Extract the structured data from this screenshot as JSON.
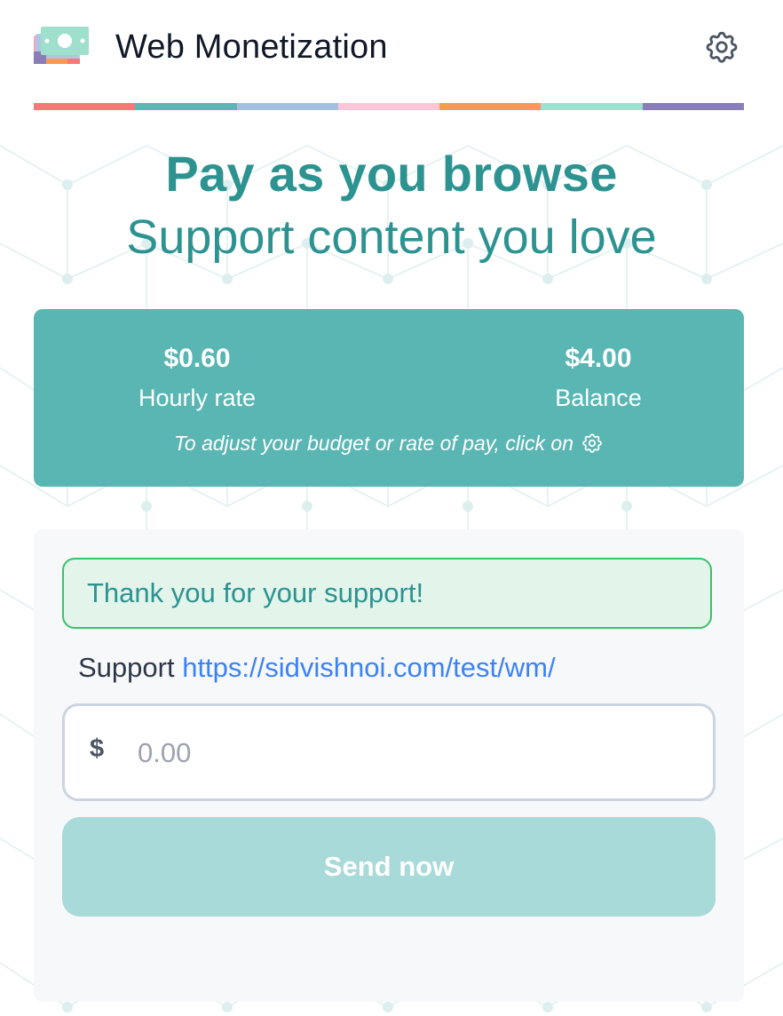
{
  "header": {
    "title": "Web Monetization",
    "logo_icon": "money-bill-icon",
    "settings_icon": "gear-icon"
  },
  "rainbow_colors": [
    "#f87878",
    "#5bb7b4",
    "#a4bfdf",
    "#fdc6d6",
    "#f89a53",
    "#9fe0cc",
    "#8a7db8"
  ],
  "hero": {
    "headline": "Pay as you browse",
    "subheadline": "Support content you love"
  },
  "stats": {
    "hourly_rate_value": "$0.60",
    "hourly_rate_label": "Hourly rate",
    "balance_value": "$4.00",
    "balance_label": "Balance",
    "hint": "To adjust your budget or rate of pay, click on",
    "hint_icon": "gear-icon"
  },
  "support": {
    "alert": "Thank you for your support!",
    "label": "Support",
    "url": "https://sidvishnoi.com/test/wm/",
    "currency_symbol": "$",
    "amount_placeholder": "0.00",
    "amount_value": "",
    "send_label": "Send now"
  },
  "colors": {
    "accent": "#2c9391",
    "card": "#59b6b3",
    "send_button": "#a7dad8",
    "alert_border": "#3cc16b",
    "link": "#3b82f6"
  }
}
